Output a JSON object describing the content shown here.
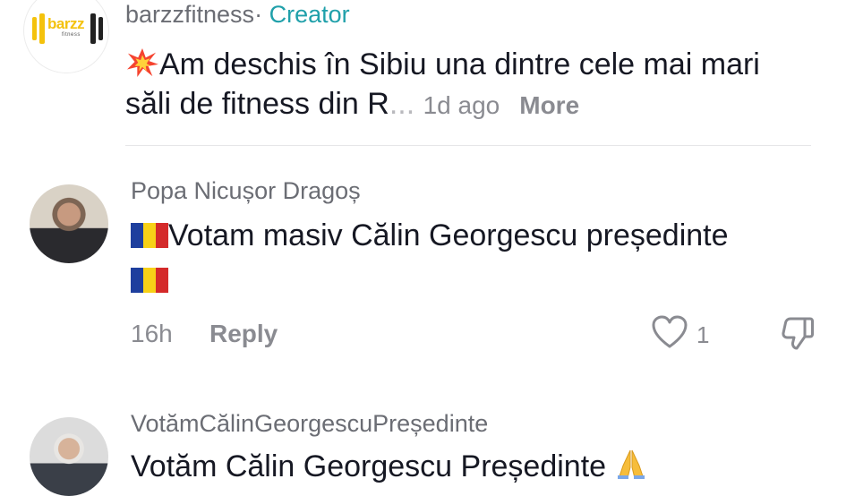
{
  "post": {
    "username": "barzzfitness",
    "separator": "·",
    "badge": "Creator",
    "text": "Am deschis în Sibiu una dintre cele mai mari săli de fitness din R",
    "text_fade": "...",
    "time": "1d ago",
    "more_label": "More",
    "logo_word": "barzz",
    "logo_sub": "fitness"
  },
  "comments": [
    {
      "username": "Popa Nicușor Dragoș",
      "text": "Votam masiv Călin Georgescu președinte",
      "time": "16h",
      "reply_label": "Reply",
      "likes": "1"
    },
    {
      "username": "VotămCălinGeorgescuPreședinte",
      "text": "Votăm Călin Georgescu Președinte"
    }
  ],
  "colors": {
    "creator_badge": "#20a0aa",
    "muted_text": "#8a8b91",
    "primary_text": "#161823"
  },
  "icons": {
    "burst": "collision-emoji",
    "flag": "romania-flag-emoji",
    "like": "heart-outline-icon",
    "dislike": "thumbs-down-outline-icon",
    "pray": "folded-hands-emoji"
  }
}
